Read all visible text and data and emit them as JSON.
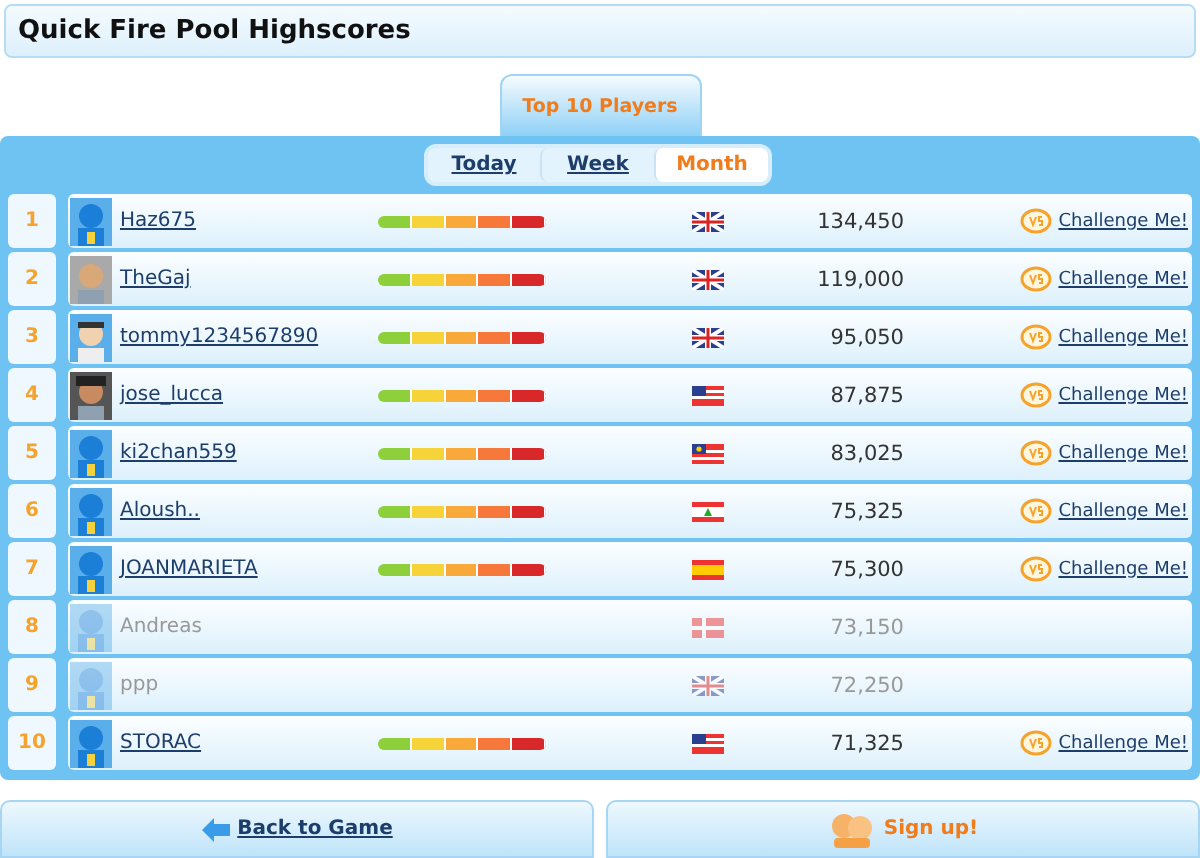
{
  "title": "Quick Fire Pool Highscores",
  "main_tab": {
    "label": "Top 10 Players",
    "selected": true
  },
  "periods": [
    {
      "label": "Today",
      "selected": false
    },
    {
      "label": "Week",
      "selected": false
    },
    {
      "label": "Month",
      "selected": true
    }
  ],
  "rows": [
    {
      "rank": "1",
      "avatar": {
        "kind": "default"
      },
      "name": "Haz675",
      "active": true,
      "flag": {
        "kind": "uk"
      },
      "score": "134,450",
      "challenge": "Challenge Me!"
    },
    {
      "rank": "2",
      "avatar": {
        "kind": "bald"
      },
      "name": "TheGaj",
      "active": true,
      "flag": {
        "kind": "uk"
      },
      "score": "119,000",
      "challenge": "Challenge Me!"
    },
    {
      "rank": "3",
      "avatar": {
        "kind": "sunglasses"
      },
      "name": "tommy1234567890",
      "active": true,
      "flag": {
        "kind": "uk"
      },
      "score": "95,050",
      "challenge": "Challenge Me!"
    },
    {
      "rank": "4",
      "avatar": {
        "kind": "hat"
      },
      "name": "jose_lucca",
      "active": true,
      "flag": {
        "kind": "us"
      },
      "score": "87,875",
      "challenge": "Challenge Me!"
    },
    {
      "rank": "5",
      "avatar": {
        "kind": "default"
      },
      "name": "ki2chan559",
      "active": true,
      "flag": {
        "kind": "my"
      },
      "score": "83,025",
      "challenge": "Challenge Me!"
    },
    {
      "rank": "6",
      "avatar": {
        "kind": "default"
      },
      "name": "Aloush..",
      "active": true,
      "flag": {
        "kind": "lb"
      },
      "score": "75,325",
      "challenge": "Challenge Me!"
    },
    {
      "rank": "7",
      "avatar": {
        "kind": "default"
      },
      "name": "JOANMARIETA",
      "active": true,
      "flag": {
        "kind": "es"
      },
      "score": "75,300",
      "challenge": "Challenge Me!"
    },
    {
      "rank": "8",
      "avatar": {
        "kind": "default"
      },
      "name": "Andreas",
      "active": false,
      "flag": {
        "kind": "dk"
      },
      "score": "73,150"
    },
    {
      "rank": "9",
      "avatar": {
        "kind": "default"
      },
      "name": "ppp",
      "active": false,
      "flag": {
        "kind": "uk"
      },
      "score": "72,250"
    },
    {
      "rank": "10",
      "avatar": {
        "kind": "default"
      },
      "name": "STORAC",
      "active": true,
      "flag": {
        "kind": "us"
      },
      "score": "71,325",
      "challenge": "Challenge Me!"
    }
  ],
  "buttons": [
    {
      "kind": "back",
      "label": "Back to Game"
    },
    {
      "kind": "signup",
      "label": "Sign up!"
    }
  ]
}
